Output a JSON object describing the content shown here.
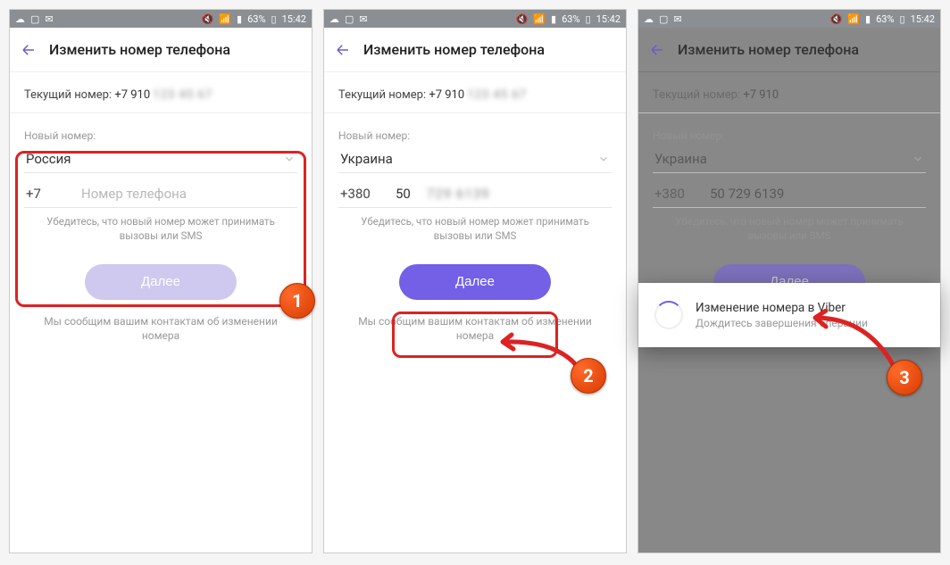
{
  "statusbar": {
    "battery": "63%",
    "time": "15:42"
  },
  "appbar": {
    "title": "Изменить номер телефона"
  },
  "labels": {
    "current_label": "Текущий номер:",
    "current_value": "+7 910",
    "new_label": "Новый номер:",
    "hint": "Убедитесь, что новый номер может принимать вызовы или SMS",
    "next": "Далее",
    "footnote": "Мы сообщим вашим контактам об изменении номера"
  },
  "screen1": {
    "country": "Россия",
    "prefix": "+7",
    "placeholder": "Номер телефона",
    "step": "1"
  },
  "screen2": {
    "country": "Украина",
    "prefix": "+380",
    "number_visible": "50",
    "step": "2"
  },
  "screen3": {
    "country": "Украина",
    "prefix": "+380",
    "number": "50 729 6139",
    "dialog_title": "Изменение номера в Viber",
    "dialog_sub": "Дождитесь завершения операции",
    "step": "3"
  }
}
